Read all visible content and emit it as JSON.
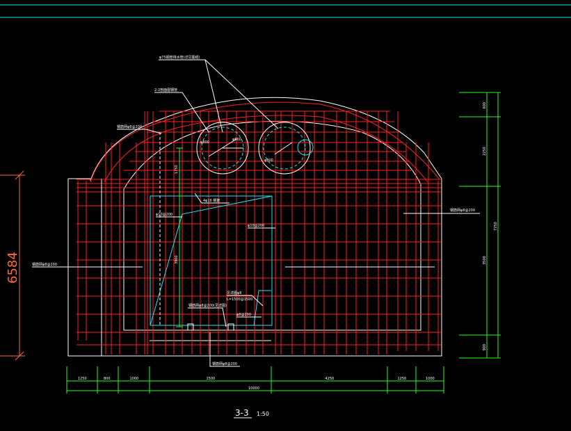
{
  "section": {
    "label": "3-3",
    "scale": "1:50"
  },
  "left_dimension": {
    "value": "6584",
    "color": "#ff6a3a"
  },
  "bottom_dimensions": {
    "segments": [
      "1250",
      "800",
      "1000",
      "1500",
      "4250",
      "1250",
      "1000"
    ],
    "total": "10000"
  },
  "right_dimensions": {
    "segments": [
      "600",
      "2250",
      "3500",
      "900"
    ],
    "total": "7250"
  },
  "inner_dimensions": {
    "vertical_upper": "1750",
    "vertical_lower": "3900"
  },
  "annotations": {
    "top_label": "φ75钢管排水管(详见图纸)",
    "pipe_label": "2-2剖面图钢管",
    "left_upper": "钢筋网φ8@200",
    "left_middle": "钢筋网φ8@200",
    "right_middle": "钢筋网φ8@200",
    "bottom": "钢筋网φ8@200",
    "opening_top": "4φ16 钢筋",
    "opening_left": "φ10@200",
    "opening_right": "φ10@200",
    "note_a": "见详图φ8",
    "note_b": "L=1500@1500",
    "note_c": "φ8@200",
    "base_note": "钢筋网φ8@200(见详图)"
  },
  "pipes": {
    "left": {
      "r1": "φ800",
      "r2": "φ860"
    },
    "right": {
      "r1": "φ800"
    }
  },
  "colors": {
    "frame": "#22e6e6",
    "outline": "#ffffff",
    "rebar": "#ff2020",
    "dimension": "#22ff22",
    "opening": "#2ae0f0"
  }
}
